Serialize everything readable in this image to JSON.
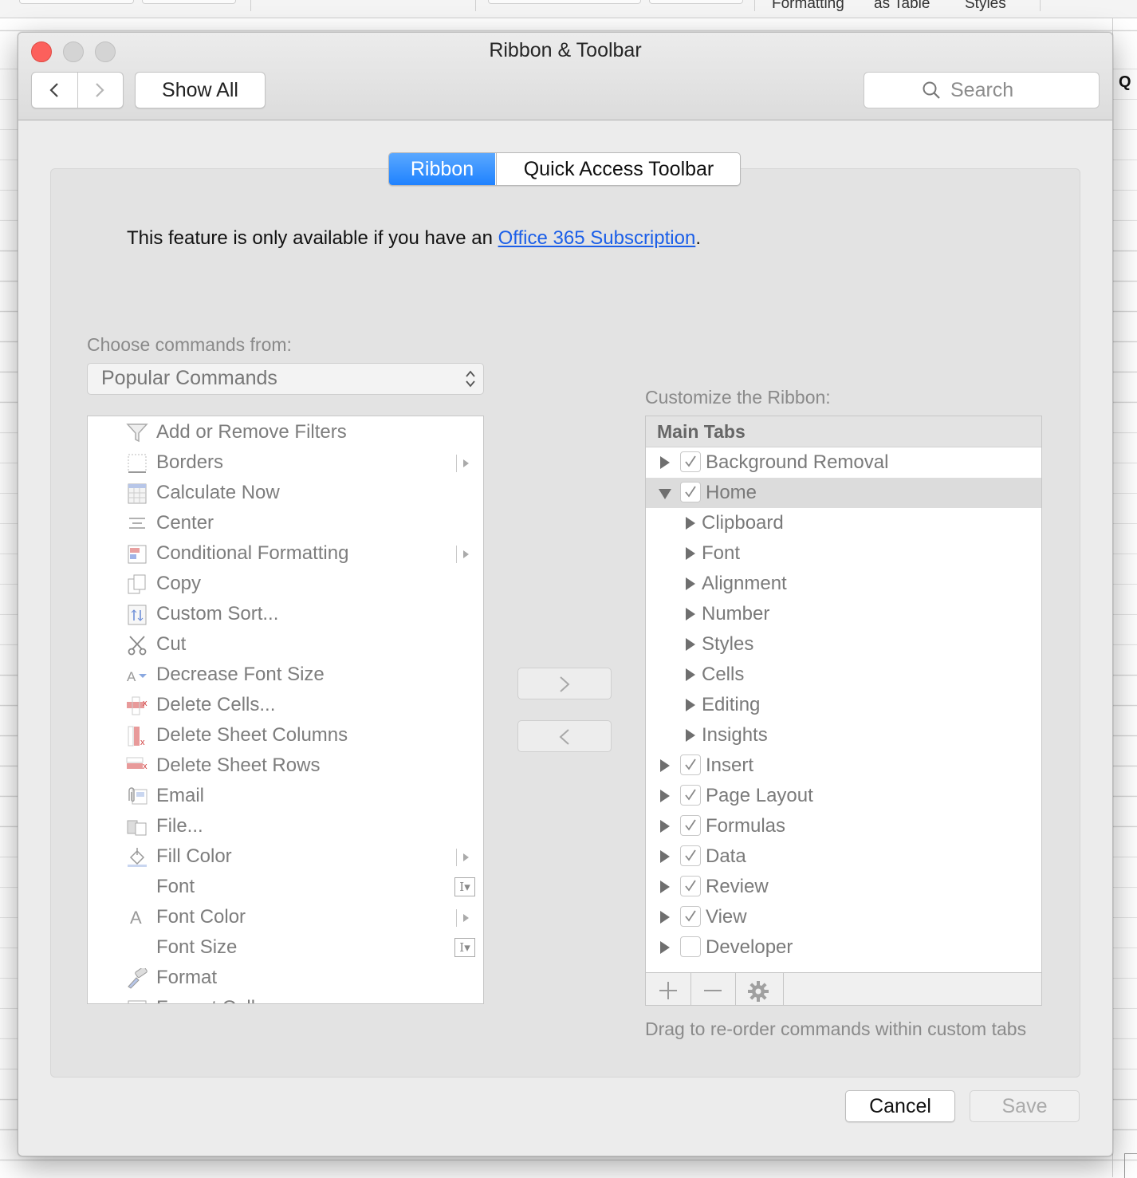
{
  "background": {
    "ribbon_fragments": [
      "Formatting",
      "as Table",
      "Styles"
    ],
    "right_text": "Q"
  },
  "window": {
    "title": "Ribbon & Toolbar",
    "show_all_label": "Show All",
    "search_placeholder": "Search"
  },
  "tabs": [
    {
      "label": "Ribbon",
      "selected": true
    },
    {
      "label": "Quick Access Toolbar",
      "selected": false
    }
  ],
  "notice": {
    "prefix": "This feature is only available if you have an ",
    "link": "Office 365 Subscription",
    "suffix": "."
  },
  "left": {
    "choose_label": "Choose commands from:",
    "source_selected": "Popular Commands",
    "commands": [
      {
        "label": "Add or Remove Filters",
        "icon": "filter-icon"
      },
      {
        "label": "Borders",
        "icon": "borders-icon",
        "submenu": true
      },
      {
        "label": "Calculate Now",
        "icon": "calculator-icon"
      },
      {
        "label": "Center",
        "icon": "align-center-icon"
      },
      {
        "label": "Conditional Formatting",
        "icon": "conditional-formatting-icon",
        "submenu": true
      },
      {
        "label": "Copy",
        "icon": "copy-icon"
      },
      {
        "label": "Custom Sort...",
        "icon": "sort-icon"
      },
      {
        "label": "Cut",
        "icon": "scissors-icon"
      },
      {
        "label": "Decrease Font Size",
        "icon": "decrease-font-icon"
      },
      {
        "label": "Delete Cells...",
        "icon": "delete-cells-icon"
      },
      {
        "label": "Delete Sheet Columns",
        "icon": "delete-columns-icon"
      },
      {
        "label": "Delete Sheet Rows",
        "icon": "delete-rows-icon"
      },
      {
        "label": "Email",
        "icon": "email-icon"
      },
      {
        "label": "File...",
        "icon": "file-icon"
      },
      {
        "label": "Fill Color",
        "icon": "fill-color-icon",
        "submenu": true
      },
      {
        "label": "Font",
        "icon": "",
        "field": true
      },
      {
        "label": "Font Color",
        "icon": "font-color-icon",
        "submenu": true
      },
      {
        "label": "Font Size",
        "icon": "",
        "field": true
      },
      {
        "label": "Format",
        "icon": "format-painter-icon"
      },
      {
        "label": "Format Cells",
        "icon": "format-cells-icon"
      }
    ]
  },
  "right": {
    "customize_label": "Customize the Ribbon:",
    "header": "Main Tabs",
    "items": [
      {
        "label": "Background Removal",
        "level": 0,
        "checked": true,
        "expanded": false
      },
      {
        "label": "Home",
        "level": 0,
        "checked": true,
        "expanded": true,
        "selected": true
      },
      {
        "label": "Clipboard",
        "level": 1
      },
      {
        "label": "Font",
        "level": 1
      },
      {
        "label": "Alignment",
        "level": 1
      },
      {
        "label": "Number",
        "level": 1
      },
      {
        "label": "Styles",
        "level": 1
      },
      {
        "label": "Cells",
        "level": 1
      },
      {
        "label": "Editing",
        "level": 1
      },
      {
        "label": "Insights",
        "level": 1
      },
      {
        "label": "Insert",
        "level": 0,
        "checked": true,
        "expanded": false
      },
      {
        "label": "Page Layout",
        "level": 0,
        "checked": true,
        "expanded": false
      },
      {
        "label": "Formulas",
        "level": 0,
        "checked": true,
        "expanded": false
      },
      {
        "label": "Data",
        "level": 0,
        "checked": true,
        "expanded": false
      },
      {
        "label": "Review",
        "level": 0,
        "checked": true,
        "expanded": false
      },
      {
        "label": "View",
        "level": 0,
        "checked": true,
        "expanded": false
      },
      {
        "label": "Developer",
        "level": 0,
        "checked": false,
        "expanded": false
      }
    ],
    "hint": "Drag to re-order commands within custom tabs"
  },
  "footer": {
    "cancel_label": "Cancel",
    "save_label": "Save"
  },
  "colors": {
    "accent": "#1f82ff",
    "link": "#1a5ee8",
    "close": "#fc605c"
  }
}
